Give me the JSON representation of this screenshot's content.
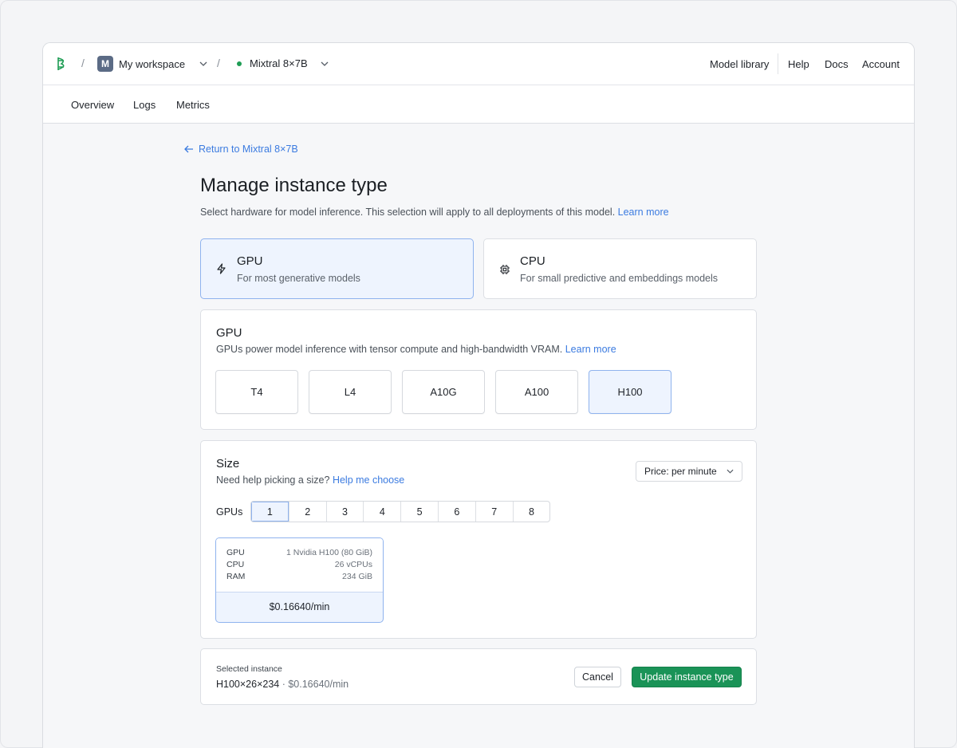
{
  "header": {
    "workspace_initial": "M",
    "workspace_name": "My workspace",
    "model_name": "Mixtral 8×7B",
    "separator": "/",
    "nav_right": [
      "Model library",
      "Help",
      "Docs",
      "Account"
    ]
  },
  "subnav": {
    "tabs": [
      "Overview",
      "Logs",
      "Metrics"
    ]
  },
  "page": {
    "back_link": "Return to Mixtral 8×7B",
    "title": "Manage instance type",
    "description": "Select hardware for model inference. This selection will apply to all deployments of this model.",
    "description_link": "Learn more"
  },
  "instance_types": [
    {
      "title": "GPU",
      "subtitle": "For most generative models",
      "icon": "lightning-icon",
      "selected": true
    },
    {
      "title": "CPU",
      "subtitle": "For small predictive and embeddings models",
      "icon": "chip-icon",
      "selected": false
    }
  ],
  "gpu_section": {
    "title": "GPU",
    "description": "GPUs power model inference with tensor compute and high-bandwidth VRAM.",
    "link": "Learn more",
    "options": [
      "T4",
      "L4",
      "A10G",
      "A100",
      "H100"
    ],
    "selected": "H100"
  },
  "size_section": {
    "title": "Size",
    "help_text": "Need help picking a size?",
    "help_link": "Help me choose",
    "price_select": "Price: per minute",
    "gpus_label": "GPUs",
    "gpu_counts": [
      "1",
      "2",
      "3",
      "4",
      "5",
      "6",
      "7",
      "8"
    ],
    "selected_count": "1",
    "spec_card": {
      "rows": [
        {
          "label": "GPU",
          "value": "1 Nvidia H100 (80 GiB)"
        },
        {
          "label": "CPU",
          "value": "26 vCPUs"
        },
        {
          "label": "RAM",
          "value": "234 GiB"
        }
      ],
      "price": "$0.16640/min"
    }
  },
  "footer": {
    "label": "Selected instance",
    "instance": "H100×26×234",
    "price_suffix": " · $0.16640/min",
    "cancel": "Cancel",
    "submit": "Update instance type"
  },
  "colors": {
    "accent": "#3b7be0",
    "selected_bg": "#eef4fe",
    "primary_button": "#1a9357",
    "status_dot": "#1f9d55"
  }
}
